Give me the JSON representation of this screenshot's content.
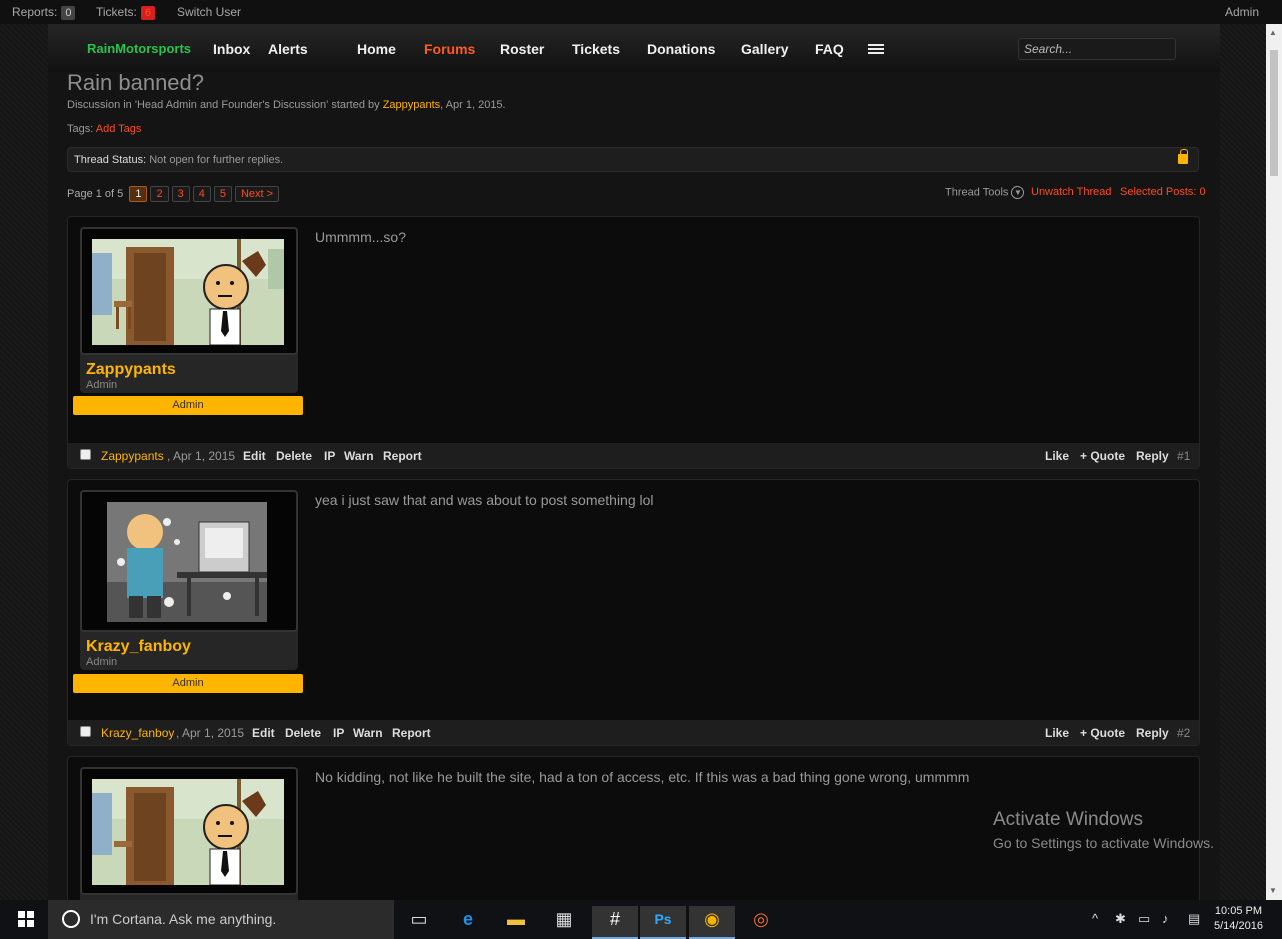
{
  "topbar": {
    "reports_label": "Reports:",
    "reports_count": "0",
    "tickets_label": "Tickets:",
    "tickets_count": "6",
    "switch_user": "Switch User",
    "account": "Admin"
  },
  "nav": {
    "brand": "RainMotorsports",
    "items": [
      "Inbox",
      "Alerts",
      "Home",
      "Forums",
      "Roster",
      "Tickets",
      "Donations",
      "Gallery",
      "FAQ"
    ],
    "active": "Forums",
    "search_placeholder": "Search..."
  },
  "thread": {
    "title": "Rain banned?",
    "meta_prefix": "Discussion in 'Head Admin and Founder's Discussion' started by",
    "author": "Zappypants",
    "meta_date": ", Apr 1, 2015.",
    "tags_label": "Tags:",
    "add_tags": "Add Tags",
    "status_label": "Thread Status:",
    "status_value": "Not open for further replies."
  },
  "pager": {
    "label": "Page 1 of 5",
    "pages": [
      "1",
      "2",
      "3",
      "4",
      "5"
    ],
    "current": "1",
    "next": "Next >"
  },
  "tools": {
    "thread_tools": "Thread Tools",
    "unwatch": "Unwatch Thread",
    "selected_posts": "Selected Posts: 0"
  },
  "posts": [
    {
      "user": "Zappypants",
      "user_title": "Admin",
      "badge": "Admin",
      "message": "Ummmm...so?",
      "date": ", Apr 1, 2015",
      "actions": [
        "Edit",
        "Delete",
        "IP",
        "Warn",
        "Report"
      ],
      "right_actions": [
        "Like",
        "+ Quote",
        "Reply"
      ],
      "number": "#1"
    },
    {
      "user": "Krazy_fanboy",
      "user_title": "Admin",
      "badge": "Admin",
      "message": "yea i just saw that and was about to post something lol",
      "date": ", Apr 1, 2015",
      "actions": [
        "Edit",
        "Delete",
        "IP",
        "Warn",
        "Report"
      ],
      "right_actions": [
        "Like",
        "+ Quote",
        "Reply"
      ],
      "number": "#2"
    },
    {
      "message": "No kidding, not like he built the site, had a ton of access, etc. If this was a bad thing gone wrong, ummmm"
    }
  ],
  "watermark": {
    "line1": "Activate Windows",
    "line2": "Go to Settings to activate Windows."
  },
  "taskbar": {
    "cortana": "I'm Cortana. Ask me anything.",
    "time": "10:05 PM",
    "date": "5/14/2016"
  },
  "colors": {
    "brand_green": "#27c44b",
    "accent_orange": "#ffb400",
    "link_red": "#ff4a1f"
  }
}
